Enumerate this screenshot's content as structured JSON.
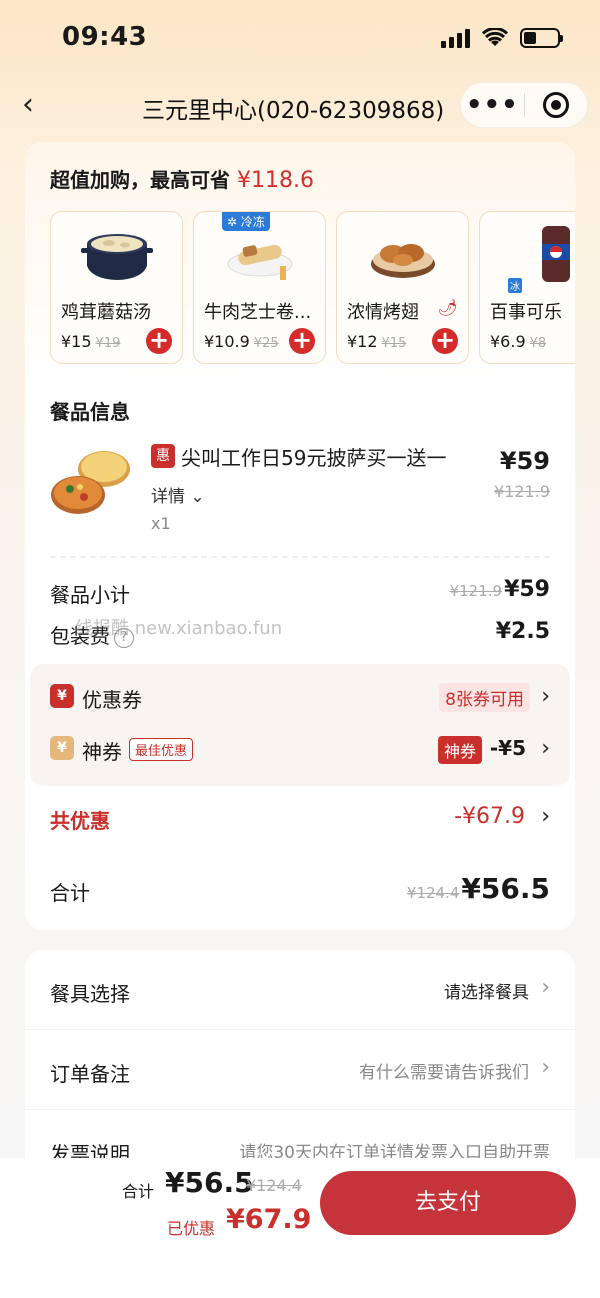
{
  "status_bar": {
    "time": "09:43"
  },
  "nav": {
    "back": "‹",
    "title": "三元里中心(020-62309868)",
    "more": "•••"
  },
  "addons": {
    "title": "超值加购，最高可省",
    "amount": "¥118.6",
    "items": [
      {
        "name": "鸡茸蘑菇汤",
        "price": "¥15",
        "orig": "¥19"
      },
      {
        "name": "牛肉芝士卷...",
        "price": "¥10.9",
        "orig": "¥25",
        "tag": "冷冻"
      },
      {
        "name": "浓情烤翅",
        "price": "¥12",
        "orig": "¥15"
      },
      {
        "name": "百事可乐",
        "price": "¥6.9",
        "orig": "¥8",
        "tag": "冰"
      }
    ]
  },
  "meal_info": {
    "label": "餐品信息",
    "badge": "惠",
    "name": "尖叫工作日59元披萨买一送一",
    "detail": "详情",
    "qty": "x1",
    "price": "¥59",
    "orig": "¥121.9"
  },
  "subtotal": {
    "label": "餐品小计",
    "orig": "¥121.9",
    "value": "¥59"
  },
  "packaging": {
    "label": "包装费",
    "help": "?",
    "value": "¥2.5"
  },
  "watermark": "线报酷 new.xianbao.fun",
  "coupon": {
    "badge": "¥",
    "label": "优惠券",
    "available": "8张券可用"
  },
  "shen": {
    "badge": "¥",
    "label": "神券",
    "best": "最佳优惠",
    "tag": "神券",
    "amount": "-¥5"
  },
  "total_discount": {
    "label": "共优惠",
    "value": "-¥67.9"
  },
  "total": {
    "label": "合计",
    "orig": "¥124.4",
    "value": "¥56.5"
  },
  "extras": [
    {
      "label": "餐具选择",
      "value": "请选择餐具"
    },
    {
      "label": "订单备注",
      "value": "有什么需要请告诉我们"
    },
    {
      "label": "发票说明",
      "value": "请您30天内在订单详情发票入口自助开票"
    }
  ],
  "bottom": {
    "total_label": "合计",
    "total": "¥56.5",
    "orig": "¥124.4",
    "disc_label": "已优惠",
    "disc": "¥67.9",
    "pay": "去支付"
  },
  "colors": {
    "accent": "#c9302c",
    "pay_button": "#c5343a"
  }
}
